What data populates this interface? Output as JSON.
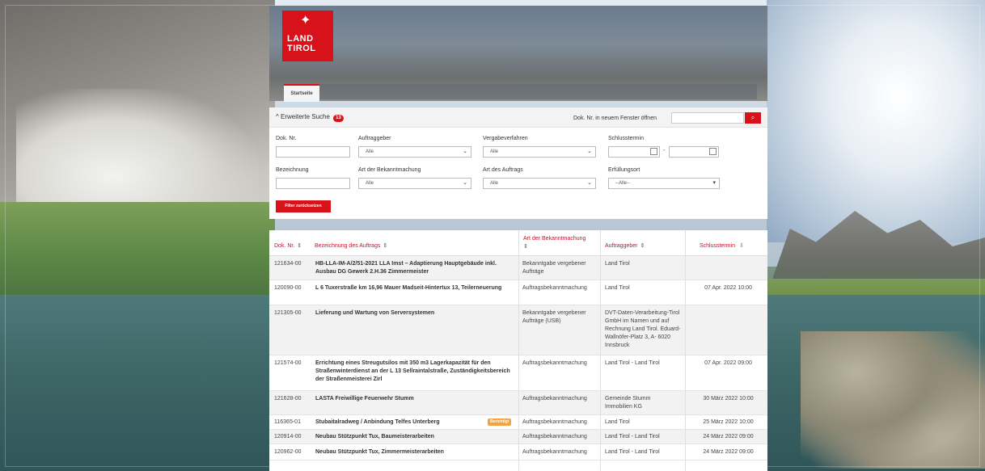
{
  "header": {
    "logo_line1": "LAND",
    "logo_line2": "TIROL",
    "nav_tab": "Startseite"
  },
  "search": {
    "toggle_label": "Erweiterte Suche",
    "badge_count": "13",
    "open_label": "Dok. Nr. in neuem Fenster öffnen",
    "open_placeholder": "",
    "fields": {
      "dok_nr": "Dok. Nr.",
      "auftraggeber": "Auftraggeber",
      "vergabeverfahren": "Vergabeverfahren",
      "schlusstermin": "Schlusstermin",
      "bezeichnung": "Bezeichnung",
      "art_bekanntmachung": "Art der Bekanntmachung",
      "art_auftrag": "Art des Auftrags",
      "erfuellungsort": "Erfüllungsort"
    },
    "selects": {
      "auftraggeber": "Alle",
      "vergabeverfahren": "Alle",
      "art_bekanntmachung": "Alle",
      "art_auftrag": "Alle",
      "erfuellungsort": "--Alle--"
    },
    "date_sep": "-",
    "reset_label": "Filter zurücksetzen"
  },
  "table": {
    "headers": {
      "dok_nr": "Dok. Nr.",
      "bezeichnung": "Bezeichnung des Auftrags",
      "art": "Art der Bekanntmachung",
      "auftraggeber": "Auftraggeber",
      "schlusstermin": "Schlusstermin"
    },
    "sort_icon": "⇕",
    "rows": [
      {
        "dok": "121634-00",
        "title": "HB-LLA-IM-A/2/51-2021 LLA Imst – Adaptierung Hauptgebäude inkl. Ausbau DG Gewerk 2.H.36 Zimmermeister",
        "art": "Bekanntgabe vergebener Aufträge",
        "ag": "Land Tirol",
        "date": ""
      },
      {
        "dok": "120090-00",
        "title": "L 6 Tuxerstraße km 16,96 Mauer Madseit-Hintertux 13, Teilerneuerung",
        "art": "Auftragsbekanntmachung",
        "ag": "Land Tirol",
        "date": "07 Apr. 2022 10:00"
      },
      {
        "dok": "121305-00",
        "title": "Lieferung und Wartung von Serversystemen",
        "art": "Bekanntgabe vergebener Aufträge (USB)",
        "ag": "DVT-Daten-Verarbeitung-Tirol GmbH im Namen und auf Rechnung Land Tirol. Eduard-Wallnöfer-Platz 3, A- 6020 Innsbruck",
        "date": ""
      },
      {
        "dok": "121574-00",
        "title": "Errichtung eines Streugutsilos mit 350 m3 Lagerkapazität für den Straßenwinterdienst an der L 13 Sellraintalstraße, Zuständigkeitsbereich der Straßenmeisterei Zirl",
        "art": "Auftragsbekanntmachung",
        "ag": "Land Tirol - Land Tirol",
        "date": "07 Apr. 2022 09:00"
      },
      {
        "dok": "121628-00",
        "title": "LASTA Freiwillige Feuerwehr Stumm",
        "art": "Auftragsbekanntmachung",
        "ag": "Gemeinde Stumm Immobilien KG",
        "date": "30 März 2022 10:00"
      },
      {
        "dok": "116365-01",
        "title": "Stubaitalradweg / Anbindung Telfes Unterberg",
        "pill": "Berichtigt",
        "art": "Auftragsbekanntmachung",
        "ag": "Land Tirol",
        "date": "25 März 2022 10:00"
      },
      {
        "dok": "120914-00",
        "title": "Neubau Stützpunkt Tux, Baumeisterarbeiten",
        "art": "Auftragsbekanntmachung",
        "ag": "Land Tirol - Land Tirol",
        "date": "24 März 2022 09:00"
      },
      {
        "dok": "120962-00",
        "title": "Neubau Stützpunkt Tux, Zimmermeisterarbeiten",
        "art": "Auftragsbekanntmachung",
        "ag": "Land Tirol - Land Tirol",
        "date": "24 März 2022 09:00"
      }
    ]
  },
  "colors": {
    "brand_red": "#d8121a",
    "header_red": "#c8102e",
    "accent_orange": "#f4a340"
  }
}
